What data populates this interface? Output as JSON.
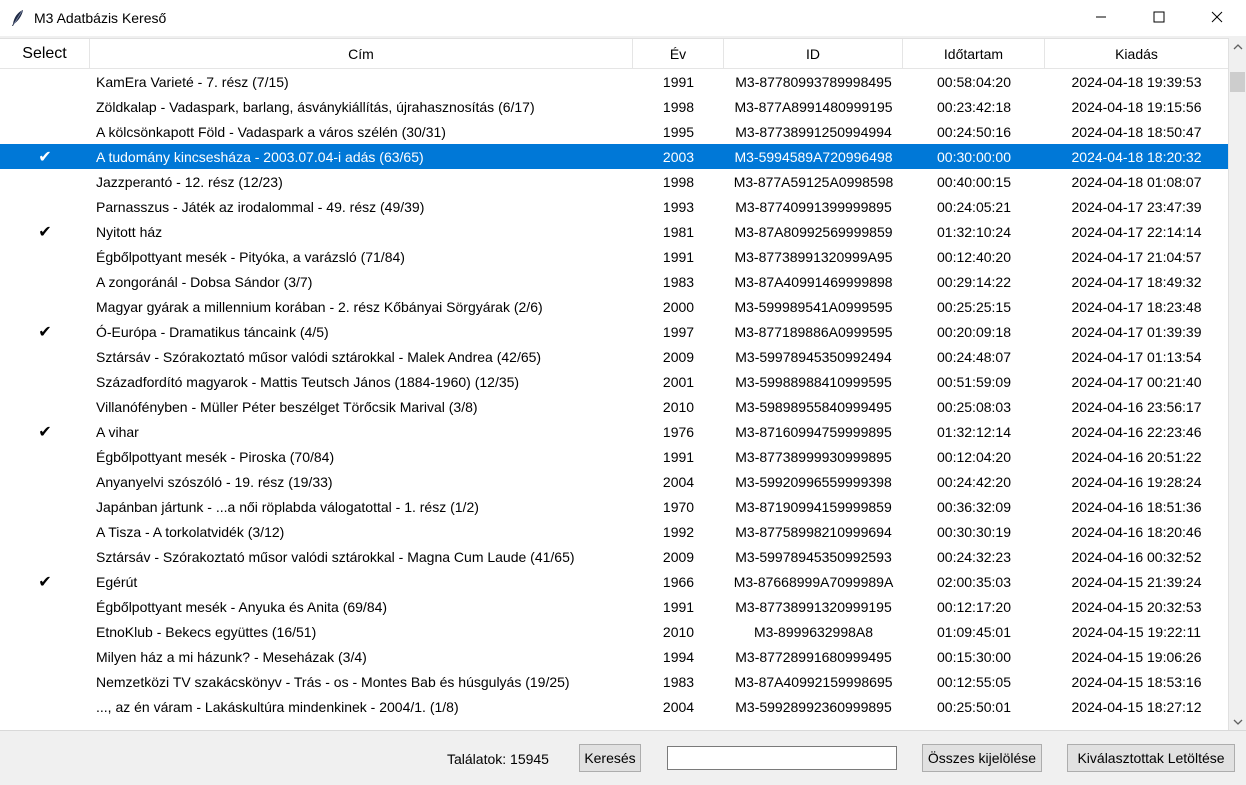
{
  "window": {
    "title": "M3 Adatbázis Kereső",
    "app_icon": "feather-icon",
    "controls": [
      "minimize-icon",
      "maximize-icon",
      "close-icon"
    ]
  },
  "table": {
    "columns": [
      "Select",
      "Cím",
      "Év",
      "ID",
      "Időtartam",
      "Kiadás"
    ],
    "check_mark": "✔",
    "selected_row_color": "#0078d7",
    "rows": [
      {
        "sel": false,
        "title": "KamEra Varieté - 7. rész (7/15)",
        "year": "1991",
        "id": "M3-87780993789998495",
        "duration": "00:58:04:20",
        "published": "2024-04-18 19:39:53",
        "highlight": false
      },
      {
        "sel": false,
        "title": "Zöldkalap - Vadaspark, barlang, ásványkiállítás, újrahasznosítás (6/17)",
        "year": "1998",
        "id": "M3-877A8991480999195",
        "duration": "00:23:42:18",
        "published": "2024-04-18 19:15:56",
        "highlight": false
      },
      {
        "sel": false,
        "title": "A kölcsönkapott Föld - Vadaspark a város szélén (30/31)",
        "year": "1995",
        "id": "M3-87738991250994994",
        "duration": "00:24:50:16",
        "published": "2024-04-18 18:50:47",
        "highlight": false
      },
      {
        "sel": true,
        "title": "A tudomány kincsesháza - 2003.07.04-i adás (63/65)",
        "year": "2003",
        "id": "M3-5994589A720996498",
        "duration": "00:30:00:00",
        "published": "2024-04-18 18:20:32",
        "highlight": true
      },
      {
        "sel": false,
        "title": "Jazzperantó - 12. rész (12/23)",
        "year": "1998",
        "id": "M3-877A59125A0998598",
        "duration": "00:40:00:15",
        "published": "2024-04-18 01:08:07",
        "highlight": false
      },
      {
        "sel": false,
        "title": "Parnasszus - Játék az irodalommal - 49. rész (49/39)",
        "year": "1993",
        "id": "M3-87740991399999895",
        "duration": "00:24:05:21",
        "published": "2024-04-17 23:47:39",
        "highlight": false
      },
      {
        "sel": true,
        "title": "Nyitott ház",
        "year": "1981",
        "id": "M3-87A80992569999859",
        "duration": "01:32:10:24",
        "published": "2024-04-17 22:14:14",
        "highlight": false
      },
      {
        "sel": false,
        "title": "Égbőlpottyant mesék - Pityóka, a varázsló (71/84)",
        "year": "1991",
        "id": "M3-87738991320999A95",
        "duration": "00:12:40:20",
        "published": "2024-04-17 21:04:57",
        "highlight": false
      },
      {
        "sel": false,
        "title": "A zongoránál - Dobsa Sándor (3/7)",
        "year": "1983",
        "id": "M3-87A40991469999898",
        "duration": "00:29:14:22",
        "published": "2024-04-17 18:49:32",
        "highlight": false
      },
      {
        "sel": false,
        "title": "Magyar gyárak a millennium korában - 2. rész Kőbányai Sörgyárak (2/6)",
        "year": "2000",
        "id": "M3-599989541A0999595",
        "duration": "00:25:25:15",
        "published": "2024-04-17 18:23:48",
        "highlight": false
      },
      {
        "sel": true,
        "title": "Ó-Európa - Dramatikus táncaink (4/5)",
        "year": "1997",
        "id": "M3-877189886A0999595",
        "duration": "00:20:09:18",
        "published": "2024-04-17 01:39:39",
        "highlight": false
      },
      {
        "sel": false,
        "title": "Sztársáv - Szórakoztató műsor valódi sztárokkal - Malek Andrea (42/65)",
        "year": "2009",
        "id": "M3-59978945350992494",
        "duration": "00:24:48:07",
        "published": "2024-04-17 01:13:54",
        "highlight": false
      },
      {
        "sel": false,
        "title": "Századfordító magyarok - Mattis Teutsch János (1884-1960) (12/35)",
        "year": "2001",
        "id": "M3-59988988410999595",
        "duration": "00:51:59:09",
        "published": "2024-04-17 00:21:40",
        "highlight": false
      },
      {
        "sel": false,
        "title": "Villanófényben - Müller Péter beszélget Törőcsik Marival (3/8)",
        "year": "2010",
        "id": "M3-59898955840999495",
        "duration": "00:25:08:03",
        "published": "2024-04-16 23:56:17",
        "highlight": false
      },
      {
        "sel": true,
        "title": "A vihar",
        "year": "1976",
        "id": "M3-87160994759999895",
        "duration": "01:32:12:14",
        "published": "2024-04-16 22:23:46",
        "highlight": false
      },
      {
        "sel": false,
        "title": "Égbőlpottyant mesék - Piroska (70/84)",
        "year": "1991",
        "id": "M3-87738999930999895",
        "duration": "00:12:04:20",
        "published": "2024-04-16 20:51:22",
        "highlight": false
      },
      {
        "sel": false,
        "title": "Anyanyelvi szószóló - 19. rész (19/33)",
        "year": "2004",
        "id": "M3-59920996559999398",
        "duration": "00:24:42:20",
        "published": "2024-04-16 19:28:24",
        "highlight": false
      },
      {
        "sel": false,
        "title": "Japánban jártunk - ...a női röplabda válogatottal - 1. rész (1/2)",
        "year": "1970",
        "id": "M3-87190994159999859",
        "duration": "00:36:32:09",
        "published": "2024-04-16 18:51:36",
        "highlight": false
      },
      {
        "sel": false,
        "title": "A Tisza - A torkolatvidék (3/12)",
        "year": "1992",
        "id": "M3-87758998210999694",
        "duration": "00:30:30:19",
        "published": "2024-04-16 18:20:46",
        "highlight": false
      },
      {
        "sel": false,
        "title": "Sztársáv - Szórakoztató műsor valódi sztárokkal - Magna Cum Laude (41/65)",
        "year": "2009",
        "id": "M3-59978945350992593",
        "duration": "00:24:32:23",
        "published": "2024-04-16 00:32:52",
        "highlight": false
      },
      {
        "sel": true,
        "title": "Egérút",
        "year": "1966",
        "id": "M3-87668999A7099989A",
        "duration": "02:00:35:03",
        "published": "2024-04-15 21:39:24",
        "highlight": false
      },
      {
        "sel": false,
        "title": "Égbőlpottyant mesék - Anyuka és Anita (69/84)",
        "year": "1991",
        "id": "M3-87738991320999195",
        "duration": "00:12:17:20",
        "published": "2024-04-15 20:32:53",
        "highlight": false
      },
      {
        "sel": false,
        "title": "EtnoKlub - Bekecs együttes (16/51)",
        "year": "2010",
        "id": "M3-8999632998A8",
        "duration": "01:09:45:01",
        "published": "2024-04-15 19:22:11",
        "highlight": false
      },
      {
        "sel": false,
        "title": "Milyen ház a mi házunk? - Meseházak (3/4)",
        "year": "1994",
        "id": "M3-87728991680999495",
        "duration": "00:15:30:00",
        "published": "2024-04-15 19:06:26",
        "highlight": false
      },
      {
        "sel": false,
        "title": "Nemzetközi TV szakácskönyv - Trás - os - Montes Bab és húsgulyás (19/25)",
        "year": "1983",
        "id": "M3-87A40992159998695",
        "duration": "00:12:55:05",
        "published": "2024-04-15 18:53:16",
        "highlight": false
      },
      {
        "sel": false,
        "title": "..., az én váram - Lakáskultúra mindenkinek - 2004/1. (1/8)",
        "year": "2004",
        "id": "M3-59928992360999895",
        "duration": "00:25:50:01",
        "published": "2024-04-15 18:27:12",
        "highlight": false
      }
    ]
  },
  "scrollbar": {
    "up_icon": "scroll-up-arrow-icon",
    "down_icon": "scroll-down-arrow-icon"
  },
  "footer": {
    "results_label": "Találatok: 15945",
    "search_button": "Keresés",
    "search_value": "",
    "select_all_button": "Összes kijelölése",
    "download_button": "Kiválasztottak Letöltése"
  }
}
